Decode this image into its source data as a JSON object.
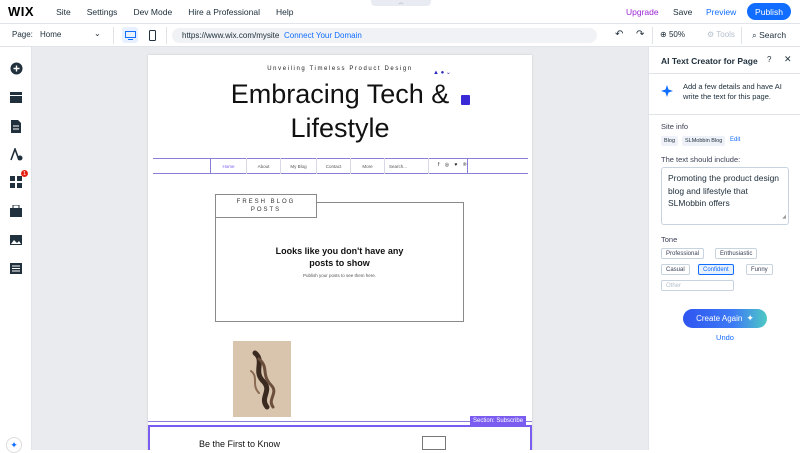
{
  "topbar": {
    "logo": "WIX",
    "menu": [
      "Site",
      "Settings",
      "Dev Mode",
      "Hire a Professional",
      "Help"
    ],
    "upgrade": "Upgrade",
    "save": "Save",
    "preview": "Preview",
    "publish": "Publish",
    "drag_glyph": "︿"
  },
  "secondbar": {
    "page_label": "Page:",
    "page_name": "Home",
    "url": "https://www.wix.com/mysite",
    "connect_domain": "Connect Your Domain",
    "zoom": "50%",
    "tools": "Tools",
    "search": "Search"
  },
  "leftbar": {
    "badge": "1",
    "icons": [
      "add-icon",
      "sections-icon",
      "pages-icon",
      "design-icon",
      "apps-icon",
      "business-icon",
      "media-icon",
      "cms-icon"
    ]
  },
  "site": {
    "tagline": "Unveiling Timeless Product Design",
    "headline_line1": "Embracing Tech &",
    "headline_line2": "Lifestyle",
    "nav": [
      "Home",
      "About",
      "My Blog",
      "Contact",
      "More",
      "Search..."
    ],
    "social": "f ◎ ♥ ℗",
    "fresh_posts": "FRESH BLOG POSTS",
    "no_posts": "Looks like you don't have any posts to show",
    "publish_hint": "Publish your posts to see them here.",
    "section_label": "Section: Subscribe",
    "first_to_know": "Be the First to Know"
  },
  "panel": {
    "title": "AI Text Creator for Page",
    "help": "?",
    "close": "✕",
    "description": "Add a few details and have AI write the text for this page.",
    "site_info_label": "Site info",
    "chips": [
      "Blog",
      "SLMobbin Blog"
    ],
    "edit": "Edit",
    "include_label": "The text should include:",
    "include_text": "Promoting the product design blog and lifestyle that SLMobbin offers",
    "tone_label": "Tone",
    "tones": [
      "Professional",
      "Enthusiastic",
      "Casual",
      "Confident",
      "Funny"
    ],
    "selected_tone": "Confident",
    "other_placeholder": "Other",
    "create_again": "Create Again",
    "undo": "Undo"
  },
  "colors": {
    "accent": "#116dff",
    "upgrade": "#9a27d5",
    "section_highlight": "#7a5cf0"
  }
}
